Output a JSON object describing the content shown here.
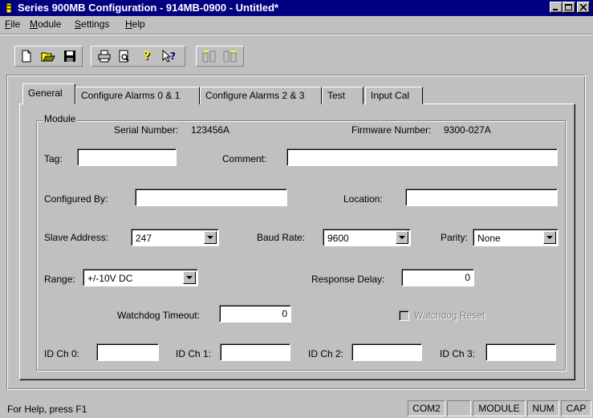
{
  "window": {
    "title": "Series 900MB Configuration - 914MB-0900 - Untitled*"
  },
  "menu": [
    {
      "pre": "",
      "u": "F",
      "post": "ile"
    },
    {
      "pre": "",
      "u": "M",
      "post": "odule"
    },
    {
      "pre": "",
      "u": "S",
      "post": "ettings"
    },
    {
      "pre": "",
      "u": "H",
      "post": "elp"
    }
  ],
  "toolbar": {
    "buttons": [
      "new-file-icon",
      "open-folder-icon",
      "save-disk-icon",
      "print-icon",
      "print-preview-icon",
      "help-icon",
      "context-help-icon",
      "read-module-icon",
      "write-module-icon"
    ]
  },
  "tabs": [
    "General",
    "Configure Alarms 0 & 1",
    "Configure Alarms 2 & 3",
    "Test",
    "Input Cal"
  ],
  "module": {
    "group_label": "Module",
    "serial_label": "Serial Number:",
    "serial_value": "123456A",
    "firmware_label": "Firmware Number:",
    "firmware_value": "9300-027A",
    "tag_label": "Tag:",
    "tag_value": "",
    "comment_label": "Comment:",
    "comment_value": "",
    "configured_by_label": "Configured By:",
    "configured_by_value": "",
    "location_label": "Location:",
    "location_value": "",
    "slave_address_label": "Slave Address:",
    "slave_address_value": "247",
    "baud_rate_label": "Baud Rate:",
    "baud_rate_value": "9600",
    "parity_label": "Parity:",
    "parity_value": "None",
    "range_label": "Range:",
    "range_value": "+/-10V DC",
    "response_delay_label": "Response Delay:",
    "response_delay_value": "0",
    "watchdog_timeout_label": "Watchdog Timeout:",
    "watchdog_timeout_value": "0",
    "watchdog_reset_label": "Watchdog Reset",
    "id_ch0_label": "ID Ch 0:",
    "id_ch1_label": "ID Ch 1:",
    "id_ch2_label": "ID Ch 2:",
    "id_ch3_label": "ID Ch 3:",
    "id_ch0_value": "",
    "id_ch1_value": "",
    "id_ch2_value": "",
    "id_ch3_value": ""
  },
  "statusbar": {
    "help_text": "For Help, press F1",
    "port": "COM2",
    "blank": "",
    "module": "MODULE",
    "num": "NUM",
    "cap": "CAP"
  }
}
